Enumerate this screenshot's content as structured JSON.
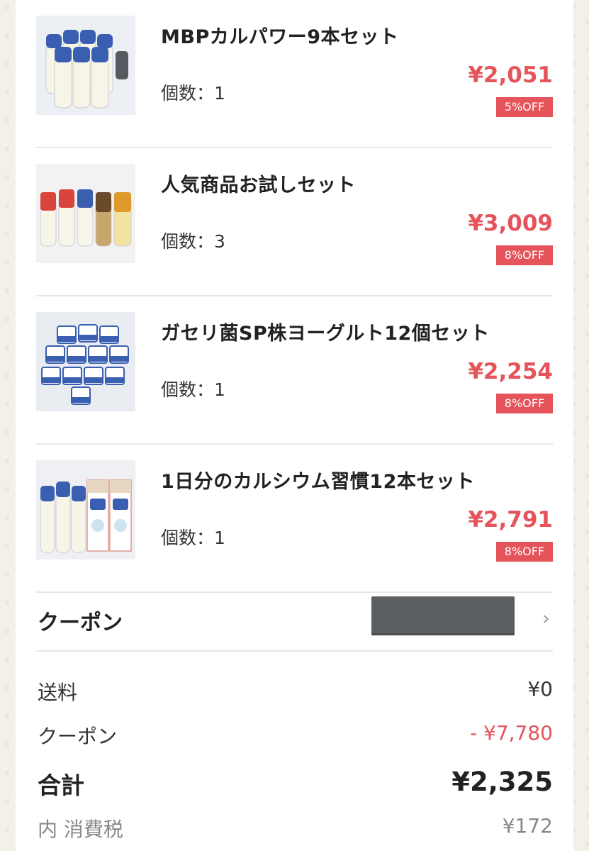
{
  "items": [
    {
      "name": "MBPカルパワー9本セット",
      "qty_label": "個数：1",
      "price": "¥2,051",
      "discount": "5%OFF",
      "image": "milk-bottles-9-image"
    },
    {
      "name": "人気商品お試しセット",
      "qty_label": "個数：3",
      "price": "¥3,009",
      "discount": "8%OFF",
      "image": "assorted-bottles-image"
    },
    {
      "name": "ガセリ菌SP株ヨーグルト12個セット",
      "qty_label": "個数：1",
      "price": "¥2,254",
      "discount": "8%OFF",
      "image": "yogurt-cups-image"
    },
    {
      "name": "1日分のカルシウム習慣12本セット",
      "qty_label": "個数：1",
      "price": "¥2,791",
      "discount": "8%OFF",
      "image": "bottles-and-cartons-image"
    }
  ],
  "coupon": {
    "label": "クーポン",
    "chevron": "chevron-right-icon"
  },
  "summary": {
    "shipping_label": "送料",
    "shipping_value": "¥0",
    "coupon_label": "クーポン",
    "coupon_value": "- ¥7,780",
    "total_label": "合計",
    "total_value": "¥2,325",
    "tax_label": "内 消費税",
    "tax_value": "¥172"
  },
  "colors": {
    "accent": "#e5545a",
    "divider": "#e7e7e7",
    "background": "#f3efe9"
  }
}
